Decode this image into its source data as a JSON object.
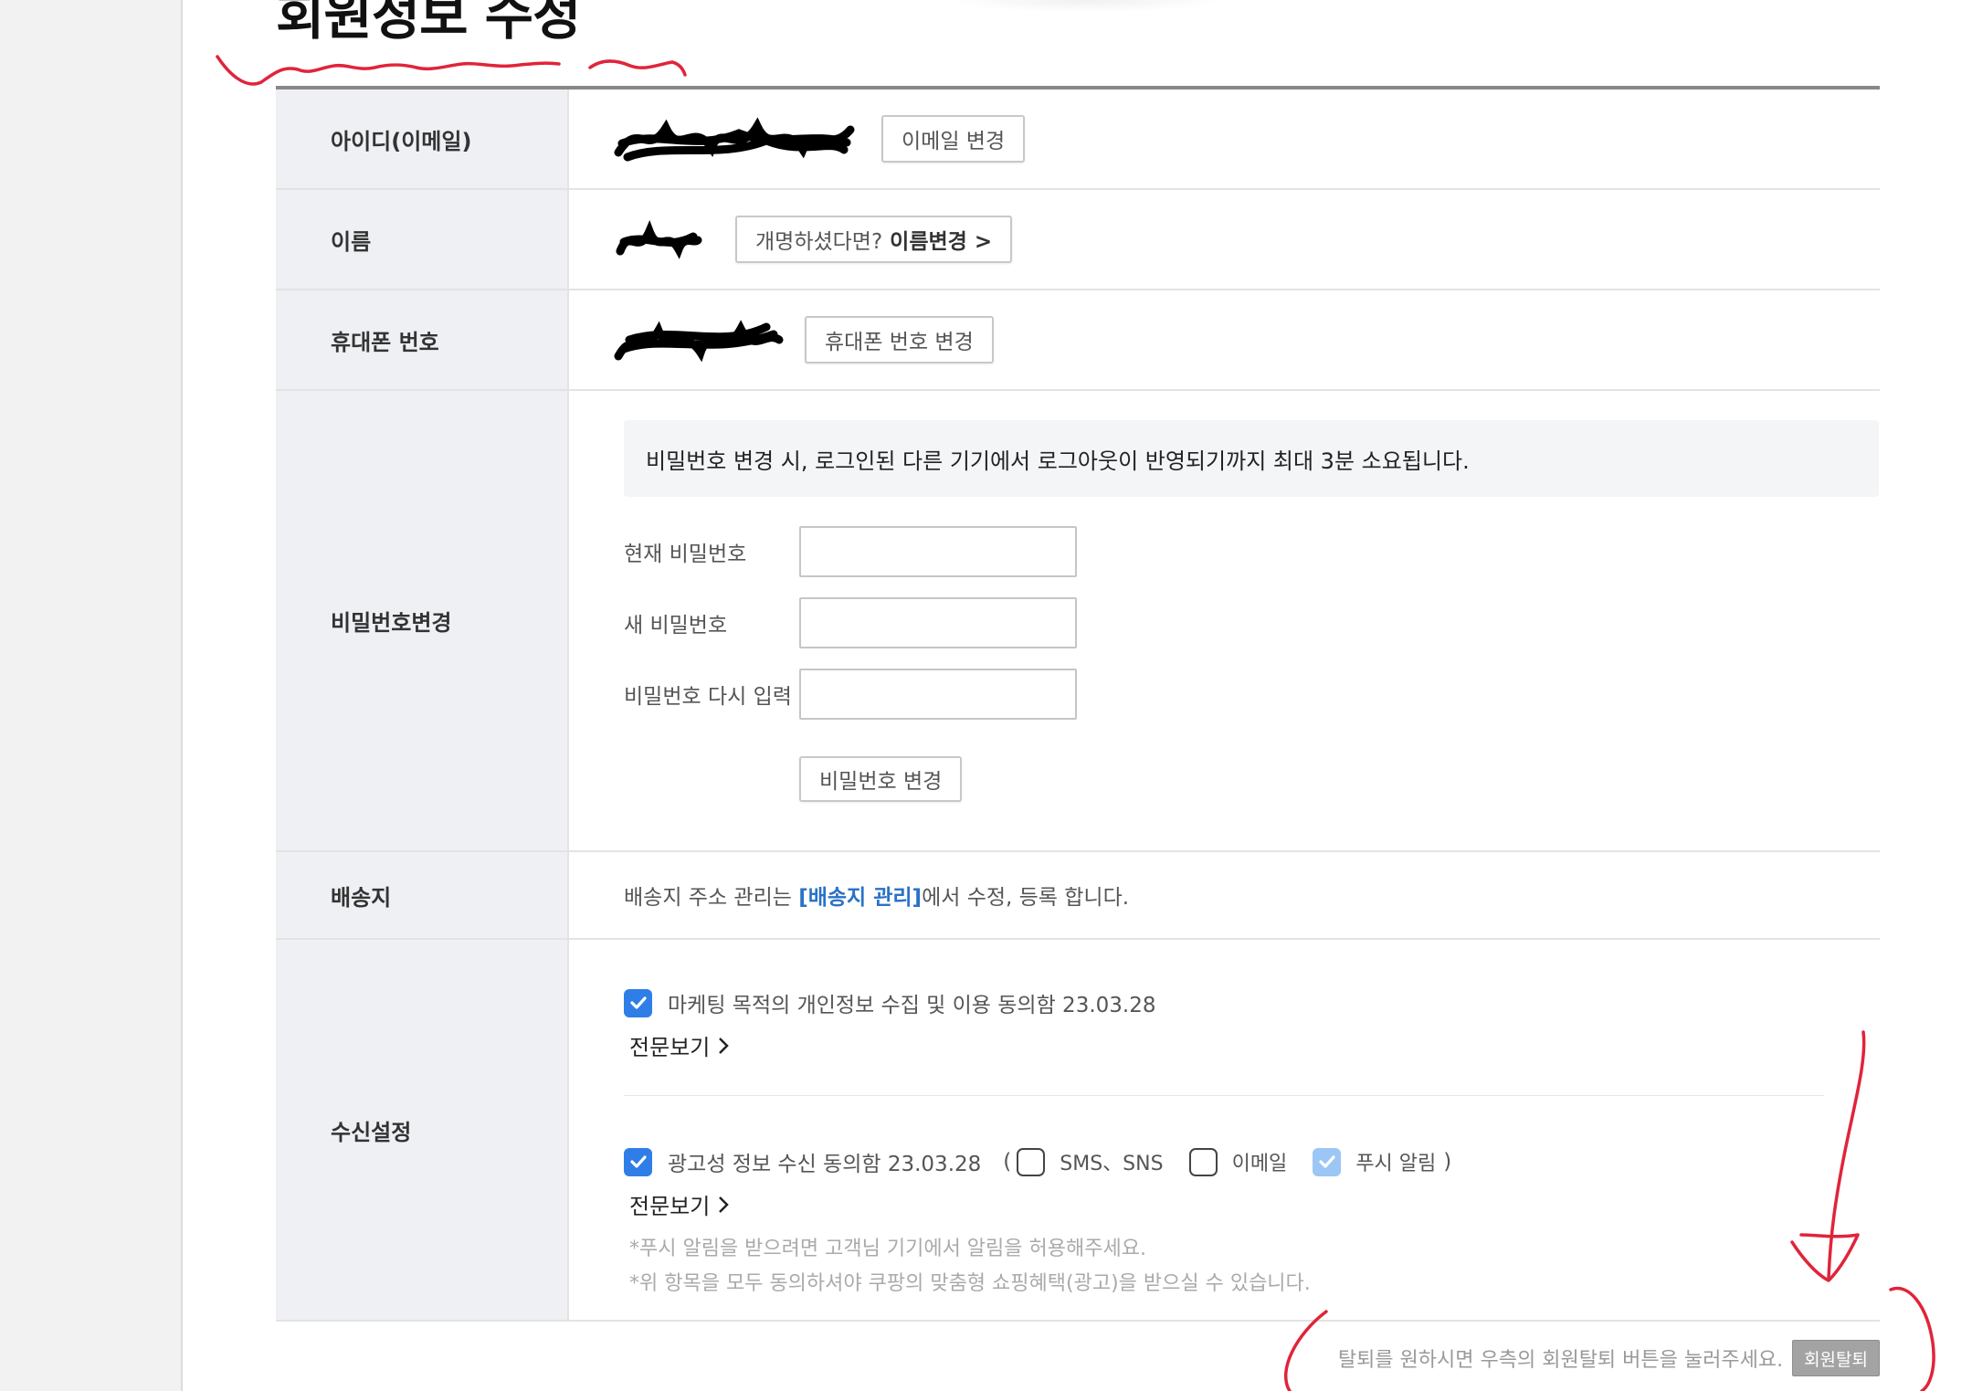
{
  "page": {
    "title": "회원정보 수정"
  },
  "rows": {
    "email": {
      "label": "아이디(이메일)",
      "button": "이메일 변경"
    },
    "name": {
      "label": "이름",
      "button_prefix": "개명하셨다면?",
      "button_strong": "이름변경 >"
    },
    "phone": {
      "label": "휴대폰 번호",
      "button": "휴대폰 번호 변경"
    },
    "password": {
      "label": "비밀번호변경",
      "notice": "비밀번호 변경 시, 로그인된 다른 기기에서 로그아웃이 반영되기까지 최대 3분 소요됩니다.",
      "current_label": "현재 비밀번호",
      "new_label": "새 비밀번호",
      "confirm_label": "비밀번호 다시 입력",
      "current_value": "",
      "new_value": "",
      "confirm_value": "",
      "submit": "비밀번호 변경"
    },
    "address": {
      "label": "배송지",
      "text_before": "배송지 주소 관리는 ",
      "link": "[배송지 관리]",
      "text_after": "에서 수정, 등록 합니다."
    },
    "receive": {
      "label": "수신설정",
      "marketing": {
        "text": "마케팅 목적의 개인정보 수집 및 이용 동의함 23.03.28",
        "checked": true,
        "view_full": "전문보기"
      },
      "ads": {
        "text": "광고성 정보 수신 동의함 23.03.28",
        "checked": true,
        "open_paren": "(",
        "close_paren": ")",
        "options": [
          {
            "label": "SMS、SNS",
            "checked": false
          },
          {
            "label": "이메일",
            "checked": false
          },
          {
            "label": "푸시 알림",
            "checked": true
          }
        ],
        "view_full": "전문보기"
      },
      "notes": [
        "*푸시 알림을 받으려면 고객님 기기에서 알림을 허용해주세요.",
        "*위 항목을 모두 동의하셔야 쿠팡의 맞춤형 쇼핑혜택(광고)을 받으실 수 있습니다."
      ]
    }
  },
  "withdraw": {
    "text": "탈퇴를 원하시면 우측의 회원탈퇴 버튼을 눌러주세요.",
    "button": "회원탈퇴"
  },
  "colors": {
    "accent": "#2f7ee8",
    "link": "#2a72c6",
    "header_bg": "#eef0f4",
    "annotation": "#e0243a"
  },
  "icons": {
    "checkbox_checked": "check-icon",
    "arrow": "chevron-right-icon"
  }
}
